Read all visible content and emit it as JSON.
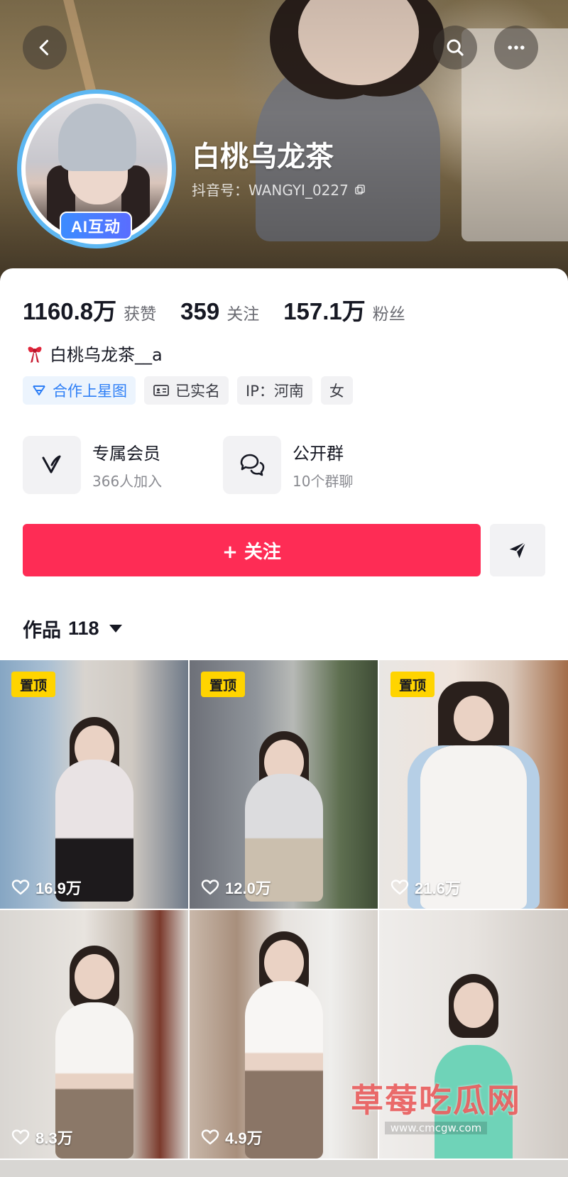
{
  "colors": {
    "accent": "#fe2c55",
    "ai_badge": "#3c8cff",
    "pin": "#ffd400",
    "tag_blue": "#2e7ff6"
  },
  "nav": {
    "back_icon": "chevron-left-icon",
    "search_icon": "search-icon",
    "more_icon": "more-horizontal-icon"
  },
  "profile": {
    "ai_badge": "AI互动",
    "nickname": "白桃乌龙茶",
    "douyin_id": "抖音号：WANGYI_0227",
    "stats": [
      {
        "value": "1160.8万",
        "label": "获赞"
      },
      {
        "value": "359",
        "label": "关注"
      },
      {
        "value": "157.1万",
        "label": "粉丝"
      }
    ],
    "bio": "白桃乌龙茶__a",
    "tags": [
      {
        "label": "合作上星图",
        "icon": "star-map-icon"
      },
      {
        "label": "已实名",
        "icon": "id-card-icon"
      },
      {
        "label": "IP：河南"
      },
      {
        "label": "女"
      }
    ],
    "features": [
      {
        "title": "专属会员",
        "subtitle": "366人加入",
        "icon": "vip-v-icon"
      },
      {
        "title": "公开群",
        "subtitle": "10个群聊",
        "icon": "group-chat-icon"
      }
    ],
    "follow_label": "+ 关注",
    "share_icon": "send-icon"
  },
  "works": {
    "label": "作品",
    "count": "118",
    "items": [
      {
        "pinned": true,
        "pin_label": "置顶",
        "likes": "16.9万"
      },
      {
        "pinned": true,
        "pin_label": "置顶",
        "likes": "12.0万"
      },
      {
        "pinned": true,
        "pin_label": "置顶",
        "likes": "21.6万"
      },
      {
        "pinned": false,
        "likes": "8.3万"
      },
      {
        "pinned": false,
        "likes": "4.9万"
      },
      {
        "pinned": false,
        "likes": ""
      }
    ]
  },
  "watermark": {
    "title": "草莓吃瓜网",
    "url": "www.cmcgw.com"
  }
}
